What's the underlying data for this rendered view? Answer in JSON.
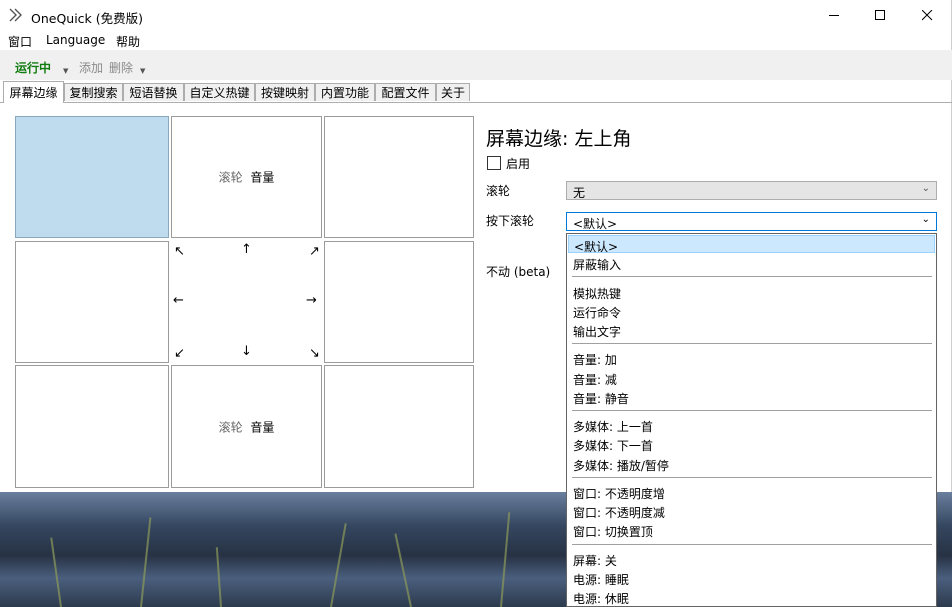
{
  "window": {
    "title": "OneQuick (免费版)",
    "app_icon": "double-chevron-icon",
    "controls": [
      "minimize-icon",
      "maximize-icon",
      "close-icon"
    ]
  },
  "menubar": {
    "items": [
      "窗口",
      "Language",
      "帮助"
    ]
  },
  "toolbar": {
    "status_label": "运行中",
    "status_color": "#107c10",
    "add_label": "添加",
    "delete_label": "删除"
  },
  "tabs": [
    "屏幕边缘",
    "复制搜索",
    "短语替换",
    "自定义热键",
    "按键映射",
    "内置功能",
    "配置文件",
    "关于"
  ],
  "active_tab": "屏幕边缘",
  "grid": {
    "top_middle": {
      "prefix": "滚轮",
      "text": "音量"
    },
    "bottom_middle": {
      "prefix": "滚轮",
      "text": "音量"
    },
    "arrows": [
      "↖",
      "↑",
      "↗",
      "←",
      "→",
      "↙",
      "↓",
      "↘"
    ]
  },
  "settings": {
    "title": "屏幕边缘: 左上角",
    "enable_label": "启用",
    "enabled": false,
    "wheel_label": "滚轮",
    "wheel_value": "无",
    "press_wheel_label": "按下滚轮",
    "press_wheel_value": "<默认>",
    "idle_label": "不动 (beta)"
  },
  "dropdown": {
    "selected": "<默认>",
    "groups": [
      [
        "<默认>",
        "屏蔽输入"
      ],
      [
        "模拟热键",
        "运行命令",
        "输出文字"
      ],
      [
        "音量: 加",
        "音量: 减",
        "音量: 静音"
      ],
      [
        "多媒体: 上一首",
        "多媒体: 下一首",
        "多媒体: 播放/暂停"
      ],
      [
        "窗口: 不透明度增",
        "窗口: 不透明度减",
        "窗口: 切换置顶"
      ],
      [
        "屏幕: 关",
        "电源: 睡眠",
        "电源: 休眠"
      ]
    ]
  },
  "colors": {
    "selected_cell": "#bedcee",
    "dropdown_highlight": "#cce8ff"
  }
}
